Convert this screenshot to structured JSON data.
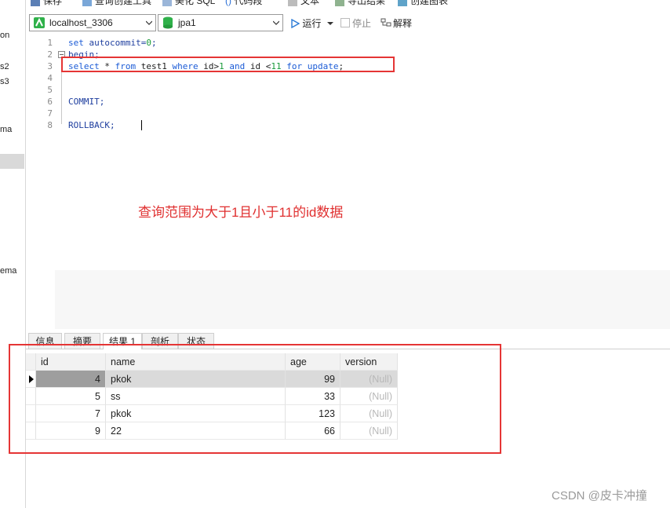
{
  "left_panel": {
    "labels": [
      "on",
      "s2",
      "s3",
      "ma",
      "ema"
    ]
  },
  "toolbar_top": {
    "items": [
      "保存",
      "查询创建工具",
      "美化 SQL",
      "代码段",
      "文本",
      "导出结果",
      "创建图表"
    ]
  },
  "connection_bar": {
    "connection": "localhost_3306",
    "database": "jpa1",
    "run_label": "运行",
    "stop_label": "停止",
    "explain_label": "解释"
  },
  "editor": {
    "line_numbers": [
      "1",
      "2",
      "3",
      "4",
      "5",
      "6",
      "7",
      "8"
    ],
    "line1": {
      "kw": "set",
      "rest": " autocommit=",
      "num": "0",
      "end": ";"
    },
    "line2": "begin;",
    "line3": {
      "t1": "select",
      "t2": " * ",
      "t3": "from",
      "t4": " test1 ",
      "t5": "where",
      "t6": " id>",
      "t7": "1",
      "t8": " ",
      "t9": "and",
      "t10": " id <",
      "t11": "11",
      "t12": " ",
      "t13": "for update",
      "t14": ";"
    },
    "line6": "COMMIT;",
    "line8": "ROLLBACK;"
  },
  "annotation_text": "查询范围为大于1且小于11的id数据",
  "tabs": [
    "信息",
    "摘要",
    "结果 1",
    "剖析",
    "状态"
  ],
  "active_tab_index": 2,
  "grid": {
    "columns": [
      "id",
      "name",
      "age",
      "version"
    ],
    "rows": [
      [
        "4",
        "pkok",
        "99",
        "(Null)"
      ],
      [
        "5",
        "ss",
        "33",
        "(Null)"
      ],
      [
        "7",
        "pkok",
        "123",
        "(Null)"
      ],
      [
        "9",
        "22",
        "66",
        "(Null)"
      ]
    ]
  },
  "watermark": "CSDN @皮卡冲撞",
  "colors": {
    "annotation_red": "#e53535",
    "keyword_blue": "#1b5bd6",
    "number_green": "#1a9a3a"
  }
}
